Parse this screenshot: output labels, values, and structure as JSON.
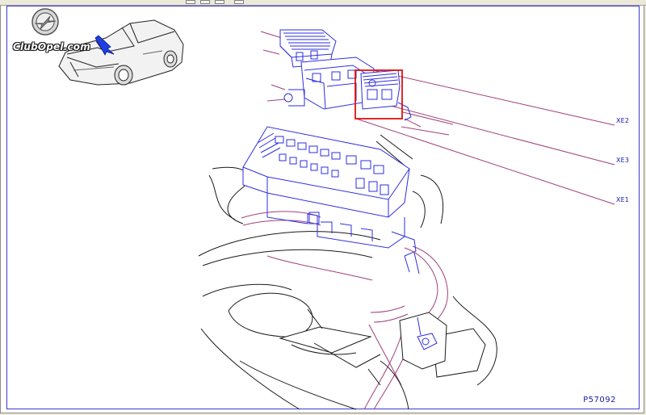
{
  "diagram": {
    "callouts": [
      {
        "id": "xe2",
        "label": "XE2"
      },
      {
        "id": "xe3",
        "label": "XE3"
      },
      {
        "id": "xe1",
        "label": "XE1"
      }
    ],
    "figure_code": "P57092"
  },
  "watermark": {
    "text": "ClubOpel.com"
  },
  "colors": {
    "component_blue": "#2e2ee0",
    "harness_magenta": "#a0407a",
    "highlight_red": "#e01010",
    "frame_blue": "#3a3ad0"
  }
}
